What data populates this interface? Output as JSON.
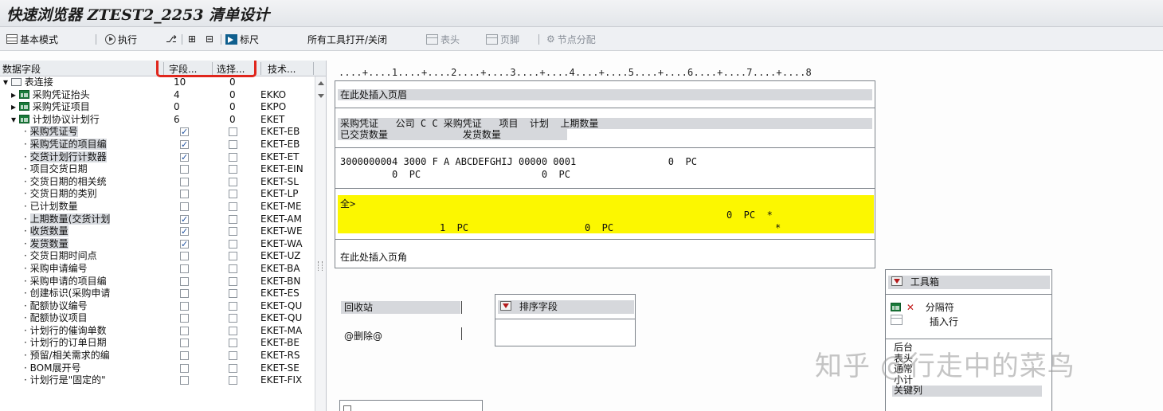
{
  "title": "快速浏览器 ZTEST2_2253 清单设计",
  "toolbar": {
    "basic_mode": "基本模式",
    "execute": "执行",
    "ruler": "标尺",
    "toggle_all": "所有工具打开/关闭",
    "header": "表头",
    "footer": "页脚",
    "node_assign": "节点分配"
  },
  "field_panel": {
    "columns": [
      "数据字段",
      "字段...",
      "选择...",
      "技术..."
    ],
    "rows": [
      {
        "level": 0,
        "type": "folder",
        "name": "表连接",
        "fields": "10",
        "select": "0",
        "tech": ""
      },
      {
        "level": 1,
        "type": "table",
        "name": "采购凭证抬头",
        "fields": "4",
        "select": "0",
        "tech": "EKKO"
      },
      {
        "level": 1,
        "type": "table",
        "name": "采购凭证项目",
        "fields": "0",
        "select": "0",
        "tech": "EKPO"
      },
      {
        "level": 1,
        "type": "table",
        "name": "计划协议计划行",
        "fields": "6",
        "select": "0",
        "tech": "EKET"
      },
      {
        "level": 2,
        "name": "采购凭证号",
        "hl": true,
        "field": true,
        "sel": false,
        "tech": "EKET-EB"
      },
      {
        "level": 2,
        "name": "采购凭证的项目编",
        "hl": true,
        "field": true,
        "sel": false,
        "tech": "EKET-EB"
      },
      {
        "level": 2,
        "name": "交货计划行计数器",
        "hl": true,
        "field": true,
        "sel": false,
        "tech": "EKET-ET"
      },
      {
        "level": 2,
        "name": "项目交货日期",
        "hl": false,
        "field": false,
        "sel": false,
        "tech": "EKET-EIN"
      },
      {
        "level": 2,
        "name": "交货日期的相关统",
        "hl": false,
        "field": false,
        "sel": false,
        "tech": "EKET-SL"
      },
      {
        "level": 2,
        "name": "交货日期的类别",
        "hl": false,
        "field": false,
        "sel": false,
        "tech": "EKET-LP"
      },
      {
        "level": 2,
        "name": "已计划数量",
        "hl": false,
        "field": false,
        "sel": false,
        "tech": "EKET-ME"
      },
      {
        "level": 2,
        "name": "上期数量(交货计划",
        "hl": true,
        "field": true,
        "sel": false,
        "tech": "EKET-AM"
      },
      {
        "level": 2,
        "name": "收货数量",
        "hl": true,
        "field": true,
        "sel": false,
        "tech": "EKET-WE"
      },
      {
        "level": 2,
        "name": "发货数量",
        "hl": true,
        "field": true,
        "sel": false,
        "tech": "EKET-WA"
      },
      {
        "level": 2,
        "name": "交货日期时间点",
        "hl": false,
        "field": false,
        "sel": false,
        "tech": "EKET-UZ"
      },
      {
        "level": 2,
        "name": "采购申请编号",
        "hl": false,
        "field": false,
        "sel": false,
        "tech": "EKET-BA"
      },
      {
        "level": 2,
        "name": "采购申请的项目编",
        "hl": false,
        "field": false,
        "sel": false,
        "tech": "EKET-BN"
      },
      {
        "level": 2,
        "name": "创建标识(采购申请",
        "hl": false,
        "field": false,
        "sel": false,
        "tech": "EKET-ES"
      },
      {
        "level": 2,
        "name": "配额协议编号",
        "hl": false,
        "field": false,
        "sel": false,
        "tech": "EKET-QU"
      },
      {
        "level": 2,
        "name": "配额协议项目",
        "hl": false,
        "field": false,
        "sel": false,
        "tech": "EKET-QU"
      },
      {
        "level": 2,
        "name": "计划行的催询单数",
        "hl": false,
        "field": false,
        "sel": false,
        "tech": "EKET-MA"
      },
      {
        "level": 2,
        "name": "计划行的订单日期",
        "hl": false,
        "field": false,
        "sel": false,
        "tech": "EKET-BE"
      },
      {
        "level": 2,
        "name": "预留/相关需求的编",
        "hl": false,
        "field": false,
        "sel": false,
        "tech": "EKET-RS"
      },
      {
        "level": 2,
        "name": "BOM展开号",
        "hl": false,
        "field": false,
        "sel": false,
        "tech": "EKET-SE"
      },
      {
        "level": 2,
        "name": "计划行是\"固定的\"",
        "hl": false,
        "field": false,
        "sel": false,
        "tech": "EKET-FIX"
      }
    ]
  },
  "ruler": "....+....1....+....2....+....3....+....4....+....5....+....6....+....7....+....8",
  "layout": {
    "header_band": "在此处插入页眉",
    "col_header_1": "采购凭证   公司 C C 采购凭证   项目  计划  上期数量",
    "col_header_2": "已交货数量             发货数量",
    "data_line_1": "3000000004 3000 F A ABCDEFGHIJ 00000 0001                0  PC",
    "data_line_2": "         0  PC                     0  PC",
    "total_label": "全>",
    "total_line_1": "0  PC  *",
    "total_line_2a": "1  PC",
    "total_line_2b": "0  PC",
    "total_line_2c": "*",
    "footer_band": "在此处插入页角"
  },
  "recycle": {
    "title": "回收站",
    "item": "@删除@"
  },
  "sort_box": {
    "title": "排序字段"
  },
  "toolbox": {
    "title": "工具箱",
    "item1": "分隔符",
    "item2": "插入行",
    "list": [
      "后台",
      "表头",
      "通常",
      "小计",
      "关键列"
    ]
  },
  "watermark": "知乎 @行走中的菜鸟",
  "colors": {
    "highlight": "#fcf700",
    "callout": "#e0261c"
  }
}
